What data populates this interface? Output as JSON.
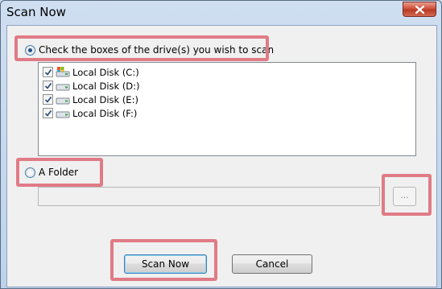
{
  "window": {
    "title": "Scan Now"
  },
  "scan_options": {
    "drives_option_label": "Check the boxes of the drive(s) you wish to scan",
    "drives_option_selected": true,
    "drives": [
      {
        "label": "Local Disk (C:)",
        "checked": true,
        "icon": "system-drive-icon"
      },
      {
        "label": "Local Disk (D:)",
        "checked": true,
        "icon": "hard-drive-icon"
      },
      {
        "label": "Local Disk (E:)",
        "checked": true,
        "icon": "hard-drive-icon"
      },
      {
        "label": "Local Disk (F:)",
        "checked": true,
        "icon": "hard-drive-icon"
      }
    ],
    "folder_option_label": "A Folder",
    "folder_option_selected": false,
    "folder_path": "",
    "browse_label": "..."
  },
  "buttons": {
    "scan_now": "Scan Now",
    "cancel": "Cancel"
  },
  "colors": {
    "highlight": "#e07b86",
    "accent": "#3c7fb1"
  }
}
